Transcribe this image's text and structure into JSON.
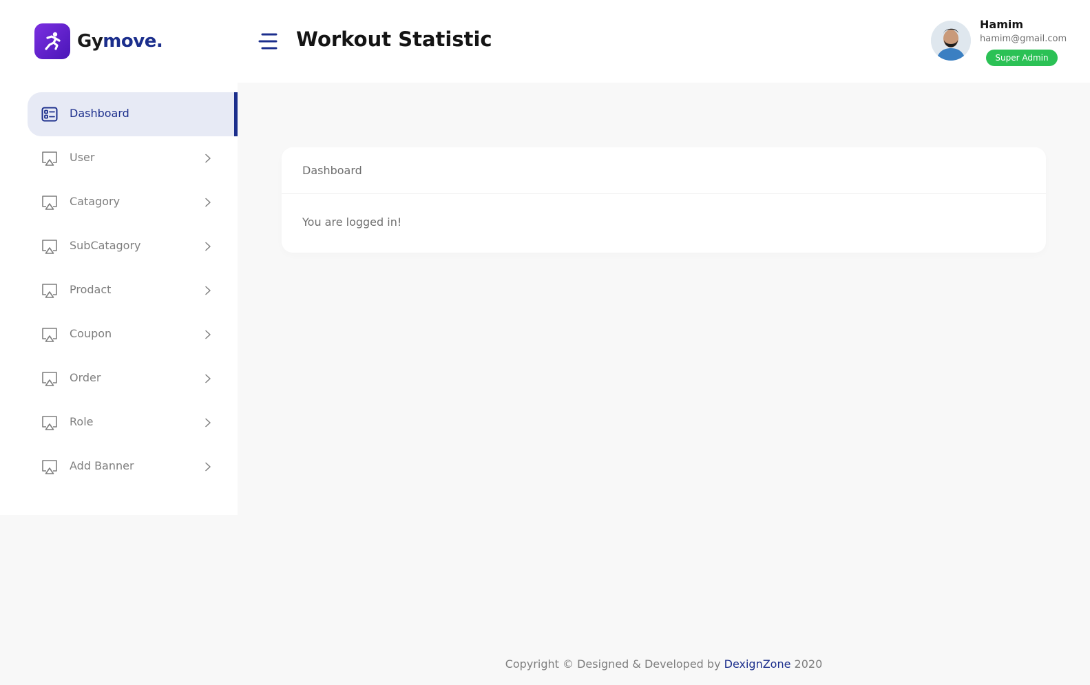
{
  "brand": {
    "name_part1": "Gy",
    "name_part2": "move.",
    "logo_icon": "running-man-icon",
    "colors": {
      "logo_gradient_start": "#7b2fe0",
      "logo_gradient_end": "#4a16b8",
      "accent": "#1b2e8c"
    }
  },
  "header": {
    "menu_icon": "hamburger-icon",
    "title": "Workout Statistic"
  },
  "profile": {
    "name": "Hamim",
    "email": "hamim@gmail.com",
    "role": "Super Admin",
    "role_color": "#2bc155"
  },
  "sidebar": {
    "items": [
      {
        "label": "Dashboard",
        "icon": "dashboard-icon",
        "active": true
      },
      {
        "label": "User",
        "icon": "monitor-icon",
        "chevron": "chevron-right-icon"
      },
      {
        "label": "Catagory",
        "icon": "monitor-icon",
        "chevron": "chevron-right-icon"
      },
      {
        "label": "SubCatagory",
        "icon": "monitor-icon",
        "chevron": "chevron-right-icon"
      },
      {
        "label": "Prodact",
        "icon": "monitor-icon",
        "chevron": "chevron-right-icon"
      },
      {
        "label": "Coupon",
        "icon": "monitor-icon",
        "chevron": "chevron-right-icon"
      },
      {
        "label": "Order",
        "icon": "monitor-icon",
        "chevron": "chevron-right-icon"
      },
      {
        "label": "Role",
        "icon": "monitor-icon",
        "chevron": "chevron-right-icon"
      },
      {
        "label": "Add Banner",
        "icon": "monitor-icon",
        "chevron": "chevron-right-icon"
      }
    ]
  },
  "card": {
    "title": "Dashboard",
    "body": "You are logged in!"
  },
  "footer": {
    "prefix": "Copyright © Designed & Developed by ",
    "link": "DexignZone",
    "suffix": " 2020"
  }
}
